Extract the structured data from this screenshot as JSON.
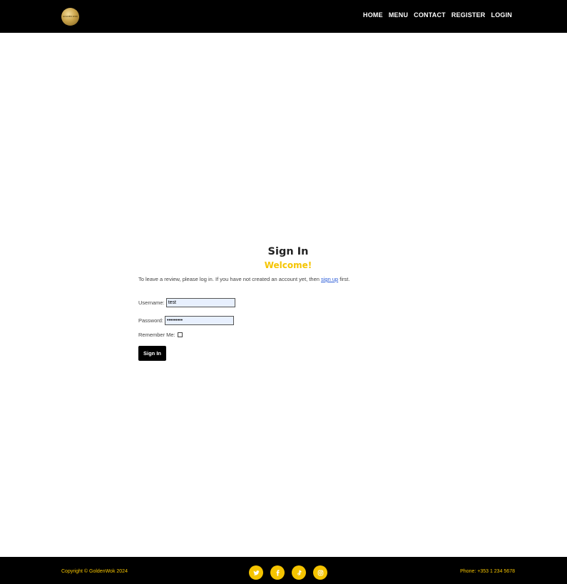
{
  "brand": {
    "logo_text": "GOLDEN WOK",
    "logo_icon": "goldenwok-logo"
  },
  "nav": {
    "items": [
      "HOME",
      "MENU",
      "CONTACT",
      "REGISTER",
      "LOGIN"
    ]
  },
  "signin": {
    "title": "Sign In",
    "welcome": "Welcome!",
    "intro_before": "To leave a review, please log in. If you have not created an account yet, then ",
    "signup_link": "sign up",
    "intro_after": " first.",
    "username_label": "Username:",
    "username_value": "test",
    "password_label": "Password:",
    "password_value": "•••••••••",
    "remember_label": "Remember Me:",
    "remember_checked": false,
    "button_label": "Sign In"
  },
  "footer": {
    "copyright": "Copyright © GoldenWok 2024",
    "phone": "Phone: +353 1 234 5678",
    "social_icons": [
      "twitter-icon",
      "facebook-icon",
      "tiktok-icon",
      "instagram-icon"
    ]
  },
  "colors": {
    "accent": "#f5c400",
    "navbar": "#000000",
    "link": "#2a5bd7",
    "input_bg": "#e8f0fe"
  }
}
